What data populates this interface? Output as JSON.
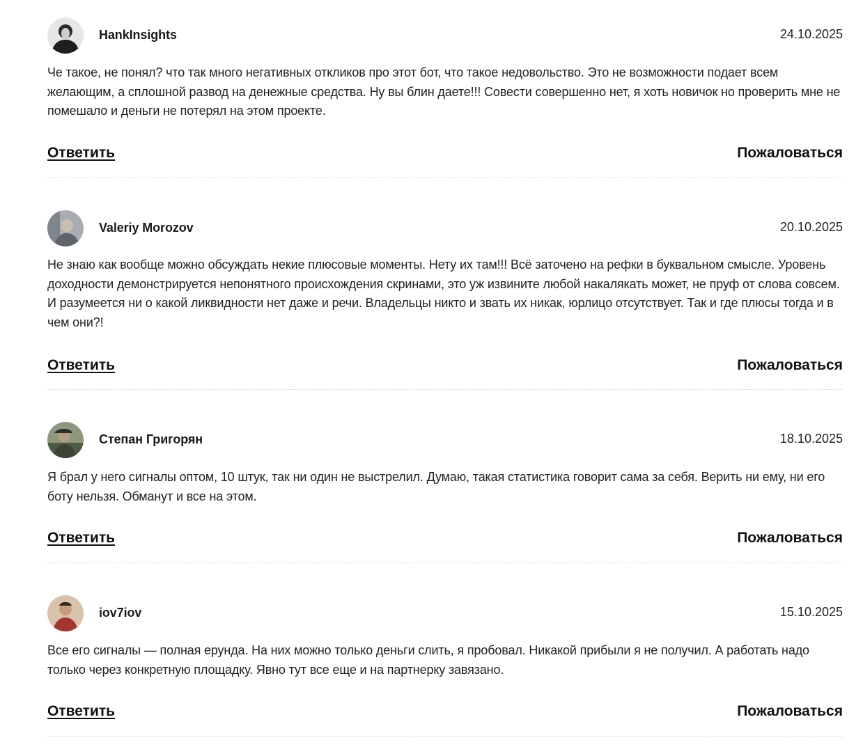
{
  "comments": [
    {
      "author": "HankInsights",
      "date": "24.10.2025",
      "text": "Че такое, не понял? что так много негативных откликов про этот бот, что такое недовольство. Это не возможности подает всем желающим, а сплошной развод на денежные средства. Ну вы блин даете!!! Совести совершенно нет, я хоть новичок но проверить мне не помешало и деньги не потерял на этом проекте.",
      "reply_label": "Ответить",
      "report_label": "Пожаловаться",
      "avatar_icon": "person-photo-icon",
      "avatar_color": "#3a3a3a"
    },
    {
      "author": "Valeriy Morozov",
      "date": "20.10.2025",
      "text": "Не знаю как вообще можно обсуждать некие плюсовые моменты. Нету их там!!! Всё заточено на рефки в буквальном смысле. Уровень доходности демонстрируется непонятного происхождения скринами, это уж извините любой накалякать может, не пруф от слова совсем. И разумеется ни о какой ликвидности нет даже и речи. Владельцы никто и звать их никак, юрлицо отсутствует. Так и где плюсы тогда и в чем они?!",
      "reply_label": "Ответить",
      "report_label": "Пожаловаться",
      "avatar_icon": "person-photo-icon",
      "avatar_color": "#9a9ca0"
    },
    {
      "author": "Степан Григорян",
      "date": "18.10.2025",
      "text": "Я брал у него сигналы оптом, 10 штук, так ни один не выстрелил. Думаю, такая статистика говорит сама за себя. Верить ни ему, ни его боту нельзя. Обманут и все на этом.",
      "reply_label": "Ответить",
      "report_label": "Пожаловаться",
      "avatar_icon": "person-photo-icon",
      "avatar_color": "#5d6a52"
    },
    {
      "author": "iov7iov",
      "date": "15.10.2025",
      "text": "Все его сигналы — полная ерунда. На них можно только деньги слить, я пробовал. Никакой прибыли я не получил. А работать надо только через конкретную площадку. Явно тут все еще и на партнерку завязано.",
      "reply_label": "Ответить",
      "report_label": "Пожаловаться",
      "avatar_icon": "person-photo-icon",
      "avatar_color": "#b07a55"
    }
  ]
}
